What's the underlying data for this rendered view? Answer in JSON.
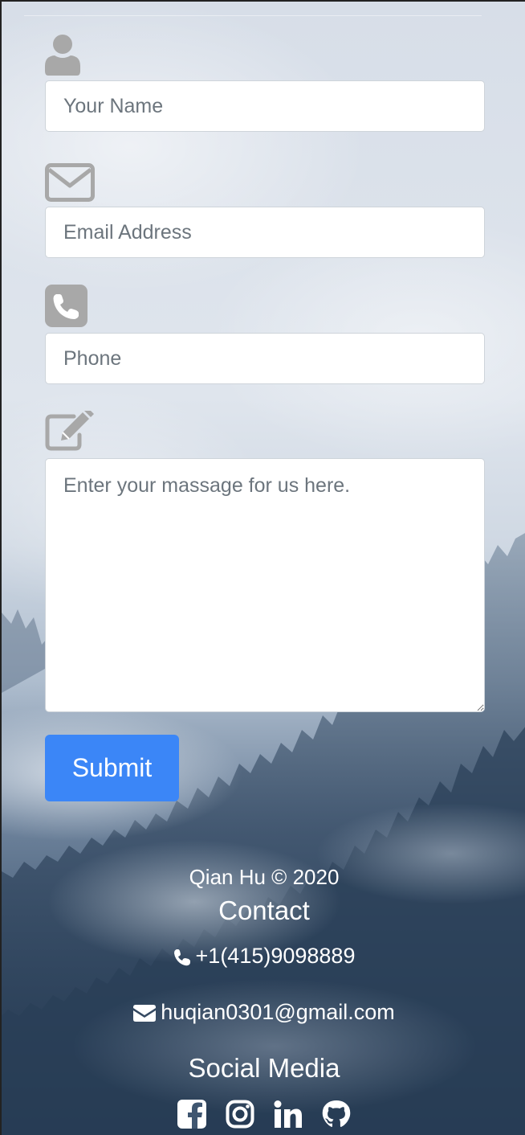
{
  "form": {
    "name": {
      "icon": "user-icon",
      "placeholder": "Your Name",
      "value": ""
    },
    "email": {
      "icon": "envelope-icon",
      "placeholder": "Email Address",
      "value": ""
    },
    "phone": {
      "icon": "phone-square-icon",
      "placeholder": "Phone",
      "value": ""
    },
    "message": {
      "icon": "edit-icon",
      "placeholder": "Enter your massage for us here.",
      "value": ""
    },
    "submit_label": "Submit"
  },
  "footer": {
    "copyright": "Qian Hu © 2020",
    "contact_heading": "Contact",
    "phone": {
      "icon": "phone-icon",
      "text": "+1(415)9098889"
    },
    "email": {
      "icon": "envelope-icon",
      "text": "huqian0301@gmail.com"
    },
    "social_heading": "Social Media",
    "social_links": [
      {
        "icon": "facebook-icon"
      },
      {
        "icon": "instagram-icon"
      },
      {
        "icon": "linkedin-icon"
      },
      {
        "icon": "github-icon"
      }
    ]
  },
  "colors": {
    "accent": "#3b86f7",
    "icon_gray": "#a8a8a8",
    "footer_text": "#ffffff"
  }
}
